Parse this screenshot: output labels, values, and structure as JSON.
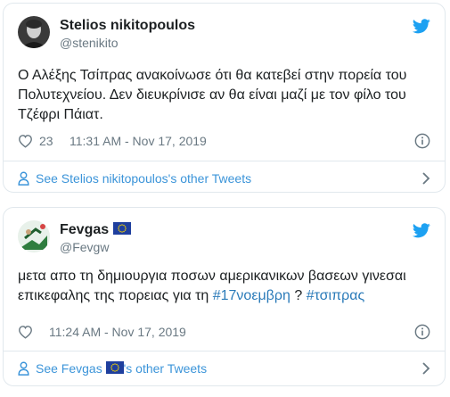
{
  "tweets": [
    {
      "author_name": "Stelios nikitopoulos",
      "author_handle": "@stenikito",
      "text": "Ο Αλέξης Τσίπρας ανακοίνωσε ότι θα κατεβεί στην πορεία του Πολυτεχνείου. Δεν διευκρίνισε αν θα είναι μαζί με τον φίλο του Τζέφρι Πάιατ.",
      "likes": "23",
      "timestamp": "11:31 AM - Nov 17, 2019",
      "footer_link": "See Stelios nikitopoulos's other Tweets"
    },
    {
      "author_name": "Fevgas",
      "author_handle": "@Fevgw",
      "text_plain": "μετα απο τη δημιουργια ποσων αμερικανικων βασεων γινεσαι επικεφαλης της πορειας για τη ",
      "hashtag_1": "#17νοεμβρη",
      "text_sep": " ? ",
      "hashtag_2": "#τσιπρας",
      "likes": "",
      "timestamp": "11:24 AM - Nov 17, 2019",
      "footer_prefix": "See Fevgas ",
      "footer_suffix": "'s other Tweets"
    }
  ],
  "icons": {
    "twitter": "twitter-bird-icon",
    "like": "heart-icon",
    "info": "info-icon",
    "profile": "person-icon",
    "chevron": "chevron-right-icon",
    "flag": "eu-flag-icon"
  },
  "colors": {
    "brand_blue": "#1da1f2",
    "link_blue": "#3b94d9",
    "hashtag_blue": "#2b7bb9",
    "muted_gray": "#697882",
    "border": "#e1e8ed",
    "text": "#1c2022"
  }
}
